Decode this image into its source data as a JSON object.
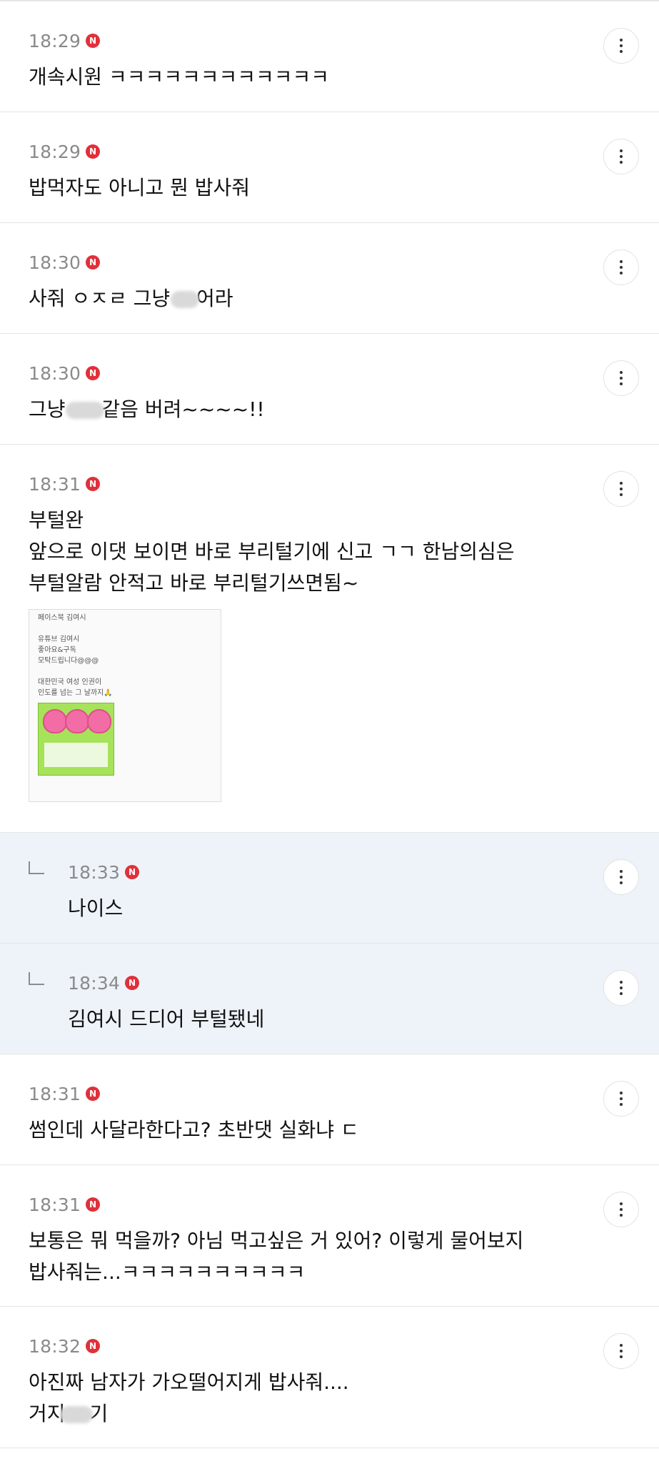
{
  "comments": [
    {
      "time": "18:29",
      "badge": "N",
      "lines": [
        "개속시원 ㅋㅋㅋㅋㅋㅋㅋㅋㅋㅋㅋㅋ"
      ]
    },
    {
      "time": "18:29",
      "badge": "N",
      "lines": [
        "밥먹자도 아니고 뭔 밥사줘"
      ]
    },
    {
      "time": "18:30",
      "badge": "N",
      "lines": [
        "사줘 ㅇㅈㄹ 그냥 ",
        "어라"
      ]
    },
    {
      "time": "18:30",
      "badge": "N",
      "lines": [
        "그냥 ",
        "같음 버려~~~~!!"
      ]
    },
    {
      "time": "18:31",
      "badge": "N",
      "lines": [
        "부털완",
        "앞으로 이댓 보이면 바로 부리털기에 신고 ㄱㄱ 한남의심은",
        "부털알람 안적고 바로 부리털기쓰면됨~"
      ],
      "attachment": {
        "lines": [
          "페이스북 김여시",
          "",
          "유튜브 김여시",
          "좋아요&구독",
          "모탁드립니다@@@",
          "",
          "대한민국 여성 인권이",
          "인도를 넘는 그 날까지🙏"
        ]
      }
    },
    {
      "time": "18:33",
      "badge": "N",
      "lines": [
        "나이스"
      ],
      "reply": true
    },
    {
      "time": "18:34",
      "badge": "N",
      "lines": [
        "김여시 드디어 부털됐네"
      ],
      "reply": true
    },
    {
      "time": "18:31",
      "badge": "N",
      "lines": [
        "썸인데 사달라한다고? 초반댓 실화냐 ㄷ"
      ]
    },
    {
      "time": "18:31",
      "badge": "N",
      "lines": [
        "보통은 뭐 먹을까? 아님 먹고싶은 거 있어? 이렇게 물어보지",
        "밥사줘는...ㅋㅋㅋㅋㅋㅋㅋㅋㅋㅋ"
      ]
    },
    {
      "time": "18:32",
      "badge": "N",
      "lines": [
        "아진짜 남자가 가오떨어지게 밥사줘....",
        "거지",
        "기"
      ]
    }
  ]
}
